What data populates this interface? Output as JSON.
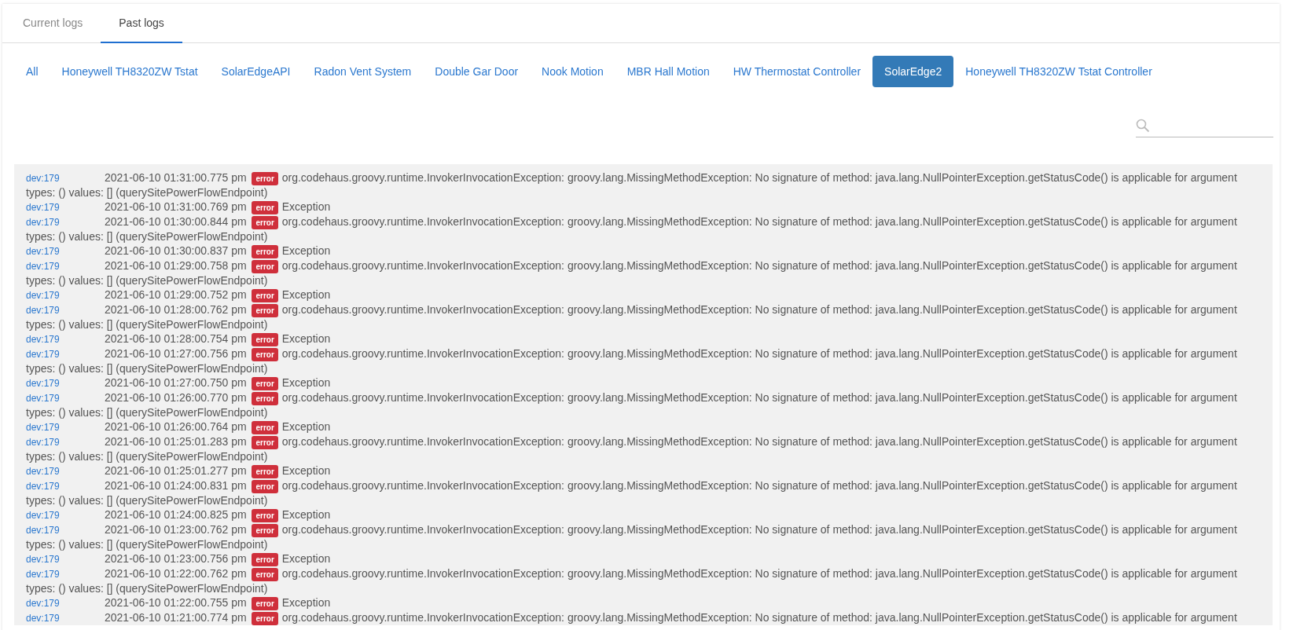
{
  "tabs": [
    {
      "label": "Current logs",
      "selected": false
    },
    {
      "label": "Past logs",
      "selected": true
    }
  ],
  "filters": [
    {
      "label": "All",
      "selected": false
    },
    {
      "label": "Honeywell TH8320ZW Tstat",
      "selected": false
    },
    {
      "label": "SolarEdgeAPI",
      "selected": false
    },
    {
      "label": "Radon Vent System",
      "selected": false
    },
    {
      "label": "Double Gar Door",
      "selected": false
    },
    {
      "label": "Nook Motion",
      "selected": false
    },
    {
      "label": "MBR Hall Motion",
      "selected": false
    },
    {
      "label": "HW Thermostat Controller",
      "selected": false
    },
    {
      "label": "SolarEdge2",
      "selected": true
    },
    {
      "label": "Honeywell TH8320ZW Tstat Controller",
      "selected": false
    }
  ],
  "logs": [
    {
      "device": "dev:179",
      "time": "2021-06-10 01:31:00.775 pm",
      "level": "error",
      "message": "org.codehaus.groovy.runtime.InvokerInvocationException: groovy.lang.MissingMethodException: No signature of method: java.lang.NullPointerException.getStatusCode() is applicable for argument",
      "continuation": "types: () values: [] (querySitePowerFlowEndpoint)"
    },
    {
      "device": "dev:179",
      "time": "2021-06-10 01:31:00.769 pm",
      "level": "error",
      "message": "Exception"
    },
    {
      "device": "dev:179",
      "time": "2021-06-10 01:30:00.844 pm",
      "level": "error",
      "message": "org.codehaus.groovy.runtime.InvokerInvocationException: groovy.lang.MissingMethodException: No signature of method: java.lang.NullPointerException.getStatusCode() is applicable for argument",
      "continuation": "types: () values: [] (querySitePowerFlowEndpoint)"
    },
    {
      "device": "dev:179",
      "time": "2021-06-10 01:30:00.837 pm",
      "level": "error",
      "message": "Exception"
    },
    {
      "device": "dev:179",
      "time": "2021-06-10 01:29:00.758 pm",
      "level": "error",
      "message": "org.codehaus.groovy.runtime.InvokerInvocationException: groovy.lang.MissingMethodException: No signature of method: java.lang.NullPointerException.getStatusCode() is applicable for argument",
      "continuation": "types: () values: [] (querySitePowerFlowEndpoint)"
    },
    {
      "device": "dev:179",
      "time": "2021-06-10 01:29:00.752 pm",
      "level": "error",
      "message": "Exception"
    },
    {
      "device": "dev:179",
      "time": "2021-06-10 01:28:00.762 pm",
      "level": "error",
      "message": "org.codehaus.groovy.runtime.InvokerInvocationException: groovy.lang.MissingMethodException: No signature of method: java.lang.NullPointerException.getStatusCode() is applicable for argument",
      "continuation": "types: () values: [] (querySitePowerFlowEndpoint)"
    },
    {
      "device": "dev:179",
      "time": "2021-06-10 01:28:00.754 pm",
      "level": "error",
      "message": "Exception"
    },
    {
      "device": "dev:179",
      "time": "2021-06-10 01:27:00.756 pm",
      "level": "error",
      "message": "org.codehaus.groovy.runtime.InvokerInvocationException: groovy.lang.MissingMethodException: No signature of method: java.lang.NullPointerException.getStatusCode() is applicable for argument",
      "continuation": "types: () values: [] (querySitePowerFlowEndpoint)"
    },
    {
      "device": "dev:179",
      "time": "2021-06-10 01:27:00.750 pm",
      "level": "error",
      "message": "Exception"
    },
    {
      "device": "dev:179",
      "time": "2021-06-10 01:26:00.770 pm",
      "level": "error",
      "message": "org.codehaus.groovy.runtime.InvokerInvocationException: groovy.lang.MissingMethodException: No signature of method: java.lang.NullPointerException.getStatusCode() is applicable for argument",
      "continuation": "types: () values: [] (querySitePowerFlowEndpoint)"
    },
    {
      "device": "dev:179",
      "time": "2021-06-10 01:26:00.764 pm",
      "level": "error",
      "message": "Exception"
    },
    {
      "device": "dev:179",
      "time": "2021-06-10 01:25:01.283 pm",
      "level": "error",
      "message": "org.codehaus.groovy.runtime.InvokerInvocationException: groovy.lang.MissingMethodException: No signature of method: java.lang.NullPointerException.getStatusCode() is applicable for argument",
      "continuation": "types: () values: [] (querySitePowerFlowEndpoint)"
    },
    {
      "device": "dev:179",
      "time": "2021-06-10 01:25:01.277 pm",
      "level": "error",
      "message": "Exception"
    },
    {
      "device": "dev:179",
      "time": "2021-06-10 01:24:00.831 pm",
      "level": "error",
      "message": "org.codehaus.groovy.runtime.InvokerInvocationException: groovy.lang.MissingMethodException: No signature of method: java.lang.NullPointerException.getStatusCode() is applicable for argument",
      "continuation": "types: () values: [] (querySitePowerFlowEndpoint)"
    },
    {
      "device": "dev:179",
      "time": "2021-06-10 01:24:00.825 pm",
      "level": "error",
      "message": "Exception"
    },
    {
      "device": "dev:179",
      "time": "2021-06-10 01:23:00.762 pm",
      "level": "error",
      "message": "org.codehaus.groovy.runtime.InvokerInvocationException: groovy.lang.MissingMethodException: No signature of method: java.lang.NullPointerException.getStatusCode() is applicable for argument",
      "continuation": "types: () values: [] (querySitePowerFlowEndpoint)"
    },
    {
      "device": "dev:179",
      "time": "2021-06-10 01:23:00.756 pm",
      "level": "error",
      "message": "Exception"
    },
    {
      "device": "dev:179",
      "time": "2021-06-10 01:22:00.762 pm",
      "level": "error",
      "message": "org.codehaus.groovy.runtime.InvokerInvocationException: groovy.lang.MissingMethodException: No signature of method: java.lang.NullPointerException.getStatusCode() is applicable for argument",
      "continuation": "types: () values: [] (querySitePowerFlowEndpoint)"
    },
    {
      "device": "dev:179",
      "time": "2021-06-10 01:22:00.755 pm",
      "level": "error",
      "message": "Exception"
    },
    {
      "device": "dev:179",
      "time": "2021-06-10 01:21:00.774 pm",
      "level": "error",
      "message": "org.codehaus.groovy.runtime.InvokerInvocationException: groovy.lang.MissingMethodException: No signature of method: java.lang.NullPointerException.getStatusCode() is applicable for argument"
    }
  ]
}
